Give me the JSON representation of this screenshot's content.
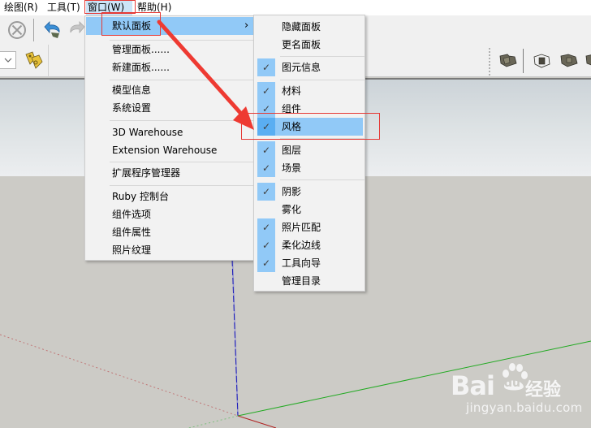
{
  "menubar": {
    "items": [
      {
        "label": "绘图(R)"
      },
      {
        "label": "工具(T)"
      },
      {
        "label": "窗口(W)",
        "active": true
      },
      {
        "label": "帮助(H)"
      }
    ]
  },
  "toolbar": {
    "icons": [
      "stop-icon",
      "undo-icon",
      "redo-icon",
      "dropdown-icon",
      "tags-icon",
      "union-icon",
      "outer-shell-icon",
      "intersect-icon",
      "subtract-icon"
    ]
  },
  "window_menu": {
    "groups": [
      [
        {
          "label": "默认面板",
          "submenu": true,
          "highlighted": true
        }
      ],
      [
        {
          "label": "管理面板......"
        },
        {
          "label": "新建面板......"
        }
      ],
      [
        {
          "label": "模型信息"
        },
        {
          "label": "系统设置"
        }
      ],
      [
        {
          "label": "3D Warehouse"
        },
        {
          "label": "Extension Warehouse"
        }
      ],
      [
        {
          "label": "扩展程序管理器"
        }
      ],
      [
        {
          "label": "Ruby 控制台"
        },
        {
          "label": "组件选项"
        },
        {
          "label": "组件属性"
        },
        {
          "label": "照片纹理"
        }
      ]
    ],
    "submenu_arrow": "›"
  },
  "default_panels_submenu": {
    "items": [
      {
        "label": "隐藏面板",
        "checked": false
      },
      {
        "label": "更名面板",
        "checked": false
      },
      {
        "label": "图元信息",
        "checked": true
      },
      {
        "label": "材料",
        "checked": true
      },
      {
        "label": "组件",
        "checked": true
      },
      {
        "label": "风格",
        "checked": true,
        "highlighted": true
      },
      {
        "label": "图层",
        "checked": true
      },
      {
        "label": "场景",
        "checked": true
      },
      {
        "label": "阴影",
        "checked": true
      },
      {
        "label": "雾化",
        "checked": false
      },
      {
        "label": "照片匹配",
        "checked": true
      },
      {
        "label": "柔化边线",
        "checked": true
      },
      {
        "label": "工具向导",
        "checked": true
      },
      {
        "label": "管理目录",
        "checked": false
      }
    ],
    "check_glyph": "✓"
  },
  "annotation": {
    "color": "#e53935"
  },
  "watermark": {
    "brand": "Bai",
    "brand_du": "du",
    "text": "经验",
    "url": "jingyan.baidu.com"
  }
}
